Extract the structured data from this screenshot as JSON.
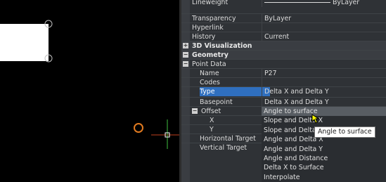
{
  "properties": {
    "rows": [
      {
        "label": "Lineweight",
        "value": "ByLayer"
      },
      {
        "label": "Transparency",
        "value": "ByLayer"
      },
      {
        "label": "Hyperlink",
        "value": ""
      },
      {
        "label": "History",
        "value": "Current"
      }
    ],
    "categories": {
      "visualization": "3D Visualization",
      "geometry": "Geometry",
      "point_data": "Point Data"
    },
    "point_rows": [
      {
        "label": "Name",
        "value": "P27"
      },
      {
        "label": "Codes",
        "value": ""
      },
      {
        "label": "Type",
        "value": "Delta X and Delta Y"
      },
      {
        "label": "Basepoint",
        "value": "Delta X and Delta Y"
      }
    ],
    "offset": {
      "label": "Offset",
      "x_label": "X",
      "y_label": "Y"
    },
    "target_rows": [
      {
        "label": "Horizontal Target"
      },
      {
        "label": "Vertical Target"
      }
    ]
  },
  "dropdown": {
    "options": [
      "Angle to surface",
      "Slope and Delta X",
      "Slope and Delta Y",
      "Angle and Delta X",
      "Angle and Delta Y",
      "Angle and Distance",
      "Delta X to Surface",
      "Interpolate"
    ],
    "hovered": "Angle to surface"
  },
  "tooltip": {
    "text": "Angle to surface"
  },
  "colors": {
    "selection": "#2f6fbf",
    "marker_circle": "#e07a20",
    "cursor": "#ffff00"
  }
}
